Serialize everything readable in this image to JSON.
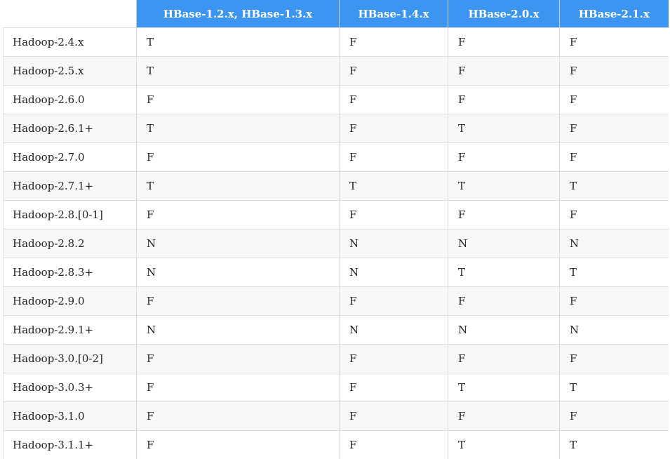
{
  "table": {
    "columns": [
      "HBase-1.2.x, HBase-1.3.x",
      "HBase-1.4.x",
      "HBase-2.0.x",
      "HBase-2.1.x"
    ],
    "rows": [
      {
        "label": "Hadoop-2.4.x",
        "values": [
          "T",
          "F",
          "F",
          "F"
        ]
      },
      {
        "label": "Hadoop-2.5.x",
        "values": [
          "T",
          "F",
          "F",
          "F"
        ]
      },
      {
        "label": "Hadoop-2.6.0",
        "values": [
          "F",
          "F",
          "F",
          "F"
        ]
      },
      {
        "label": "Hadoop-2.6.1+",
        "values": [
          "T",
          "F",
          "T",
          "F"
        ]
      },
      {
        "label": "Hadoop-2.7.0",
        "values": [
          "F",
          "F",
          "F",
          "F"
        ]
      },
      {
        "label": "Hadoop-2.7.1+",
        "values": [
          "T",
          "T",
          "T",
          "T"
        ]
      },
      {
        "label": "Hadoop-2.8.[0-1]",
        "values": [
          "F",
          "F",
          "F",
          "F"
        ]
      },
      {
        "label": "Hadoop-2.8.2",
        "values": [
          "N",
          "N",
          "N",
          "N"
        ]
      },
      {
        "label": "Hadoop-2.8.3+",
        "values": [
          "N",
          "N",
          "T",
          "T"
        ]
      },
      {
        "label": "Hadoop-2.9.0",
        "values": [
          "F",
          "F",
          "F",
          "F"
        ]
      },
      {
        "label": "Hadoop-2.9.1+",
        "values": [
          "N",
          "N",
          "N",
          "N"
        ]
      },
      {
        "label": "Hadoop-3.0.[0-2]",
        "values": [
          "F",
          "F",
          "F",
          "F"
        ]
      },
      {
        "label": "Hadoop-3.0.3+",
        "values": [
          "F",
          "F",
          "T",
          "T"
        ]
      },
      {
        "label": "Hadoop-3.1.0",
        "values": [
          "F",
          "F",
          "F",
          "F"
        ]
      },
      {
        "label": "Hadoop-3.1.1+",
        "values": [
          "F",
          "F",
          "T",
          "T"
        ]
      }
    ]
  },
  "colors": {
    "header_bg": "#3c95f0",
    "header_text": "#ffffff",
    "row_alt_bg": "#f8f8f8",
    "cell_text": "#222222"
  }
}
